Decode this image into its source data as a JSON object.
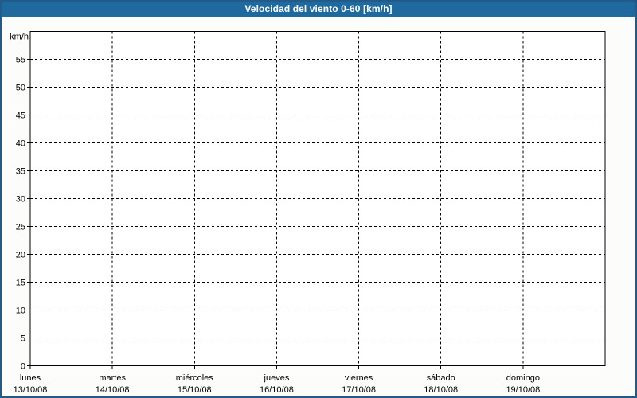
{
  "window": {
    "title": "Velocidad del viento 0-60 [km/h]"
  },
  "colors": {
    "titlebar_bg": "#1e6a9e",
    "titlebar_text": "#ffffff",
    "frame_border": "#245a87",
    "page_bg": "#fcfdfb",
    "plot_bg": "#ffffff",
    "grid": "#000000",
    "label_text": "#000000"
  },
  "chart_data": {
    "type": "line",
    "title": "Velocidad del viento 0-60 [km/h]",
    "grid_style": "dashed",
    "legend": "none",
    "y_axis": {
      "unit": "km/h",
      "min": 0,
      "max": 60,
      "tick_step": 5,
      "ticks": [
        "0",
        "5",
        "10",
        "15",
        "20",
        "25",
        "30",
        "35",
        "40",
        "45",
        "50",
        "55"
      ]
    },
    "x_axis": {
      "categories": [
        {
          "day": "lunes",
          "date": "13/10/08"
        },
        {
          "day": "martes",
          "date": "14/10/08"
        },
        {
          "day": "miércoles",
          "date": "15/10/08"
        },
        {
          "day": "jueves",
          "date": "16/10/08"
        },
        {
          "day": "viernes",
          "date": "17/10/08"
        },
        {
          "day": "sábado",
          "date": "18/10/08"
        },
        {
          "day": "domingo",
          "date": "19/10/08"
        }
      ]
    },
    "series": []
  }
}
